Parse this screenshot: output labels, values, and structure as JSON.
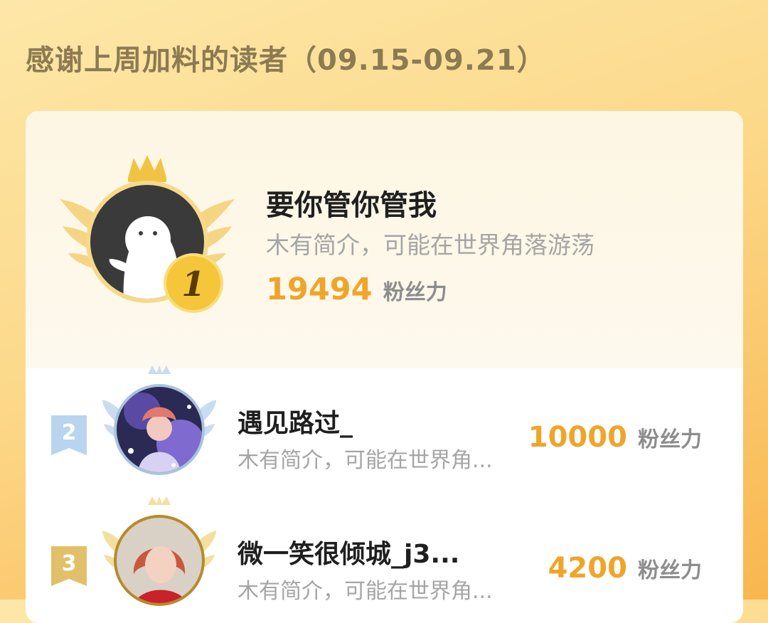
{
  "header": {
    "title": "感谢上周加料的读者（09.15-09.21）"
  },
  "ranking": {
    "fans_label": "粉丝力",
    "entries": [
      {
        "rank": "1",
        "name": "要你管你管我",
        "bio": "木有简介，可能在世界角落游荡",
        "score": "19494",
        "avatar": "default-ghost-avatar-icon"
      },
      {
        "rank": "2",
        "name": "遇见路过_",
        "bio": "木有简介，可能在世界角...",
        "score": "10000",
        "avatar": "anime-girl-avatar"
      },
      {
        "rank": "3",
        "name": "微一笑很倾城_j3...",
        "bio": "木有简介，可能在世界角...",
        "score": "4200",
        "avatar": "red-hair-photo-avatar"
      }
    ]
  },
  "colors": {
    "gold": "#efa52a",
    "silver": "#a7c6e3",
    "bronze": "#d9b35b",
    "background": "#fcd98a"
  }
}
